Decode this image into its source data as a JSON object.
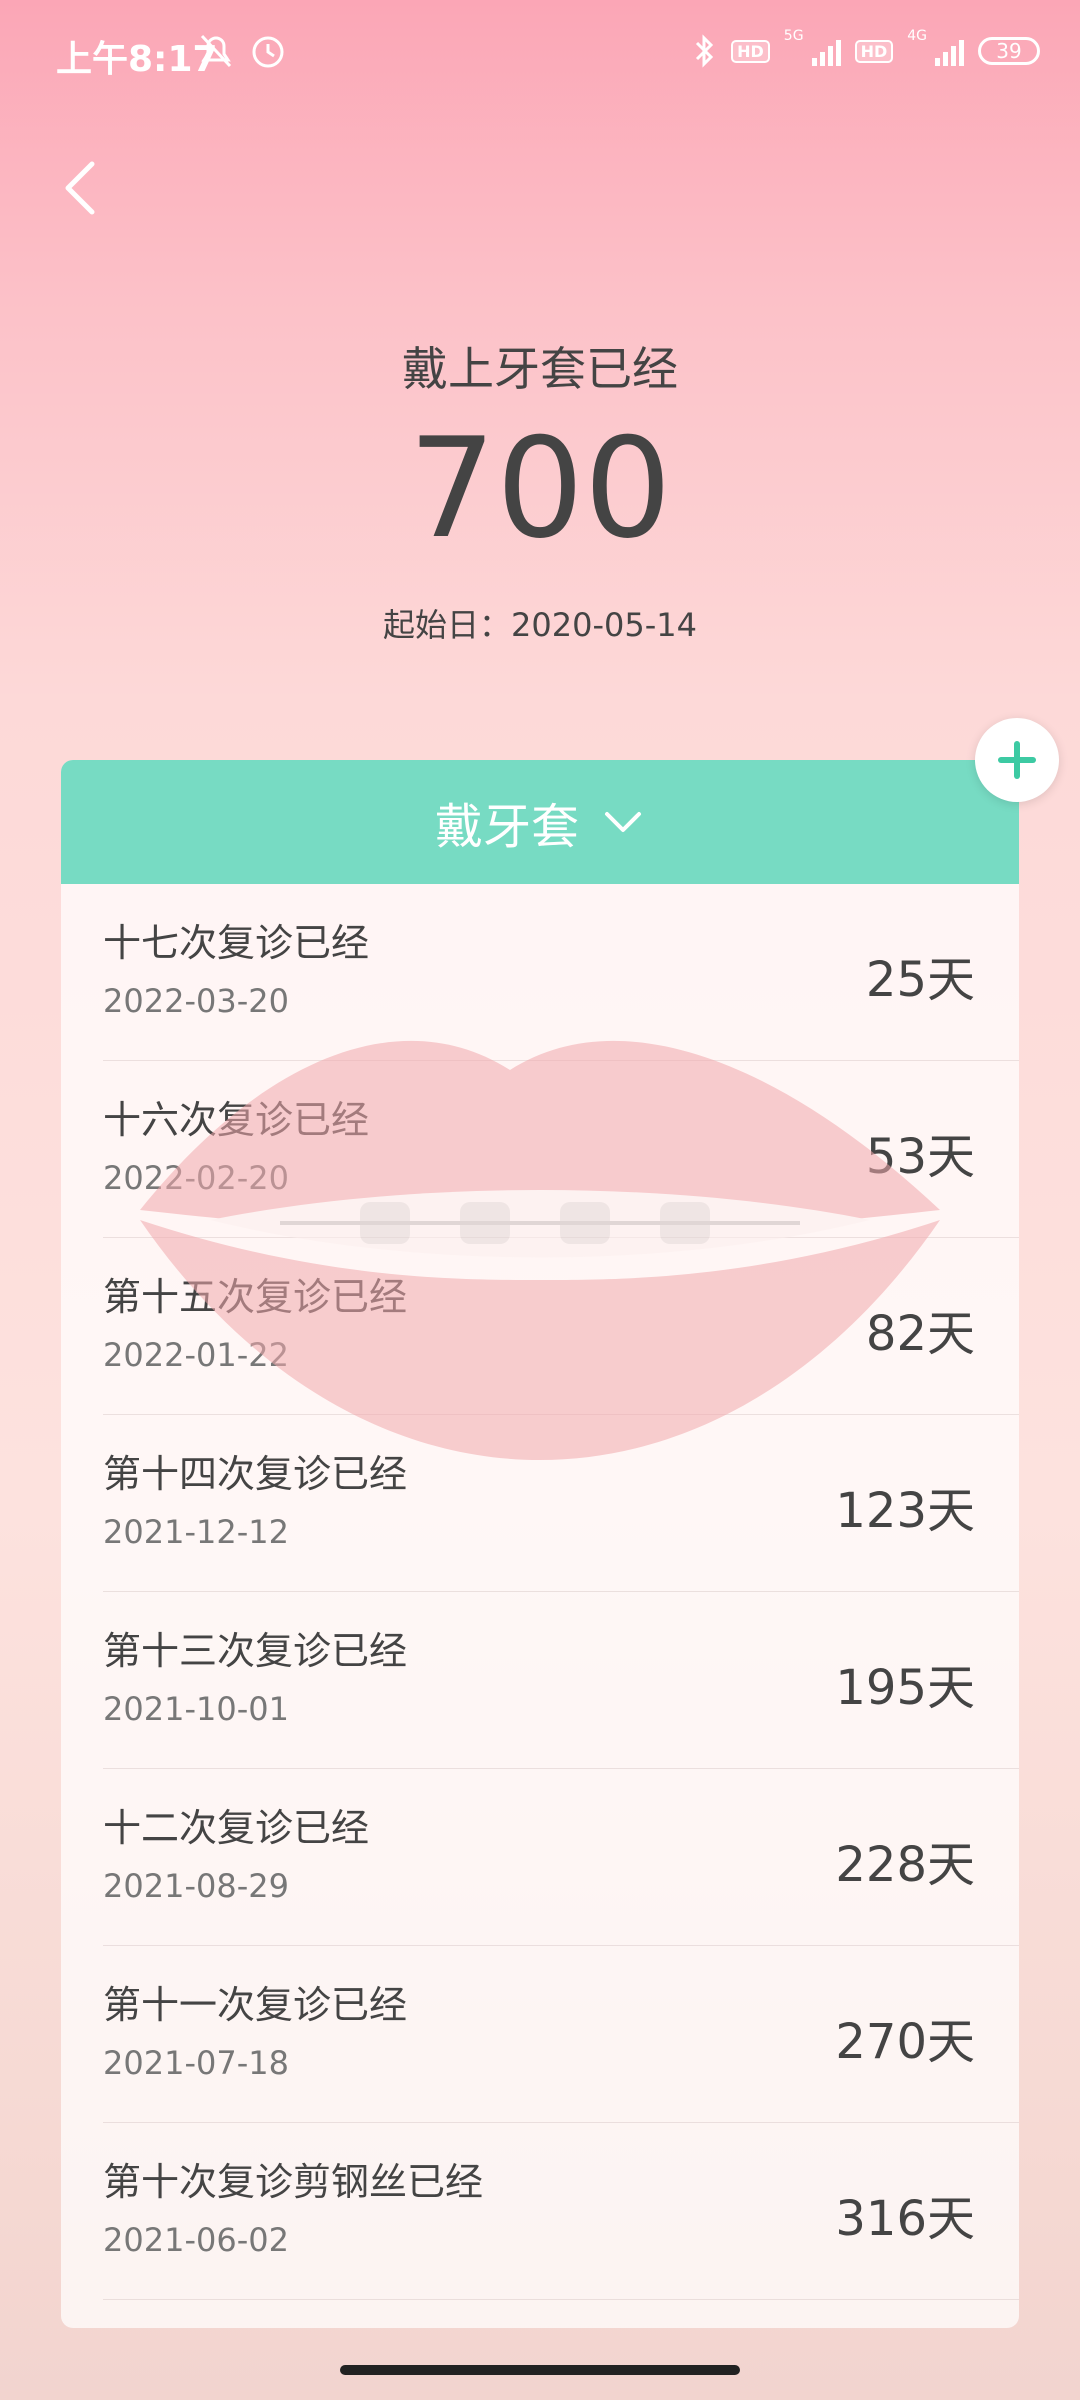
{
  "status_bar": {
    "time": "上午8:17",
    "hd1": "HD",
    "net1": "5G",
    "hd2": "HD",
    "net2": "4G",
    "battery": "39"
  },
  "header": {
    "title": "戴上牙套已经",
    "count": "700",
    "start_date": "起始日：2020-05-14"
  },
  "panel": {
    "category": "戴牙套"
  },
  "list": [
    {
      "title": "十七次复诊已经",
      "date": "2022-03-20",
      "days": "25天"
    },
    {
      "title": "十六次复诊已经",
      "date": "2022-02-20",
      "days": "53天"
    },
    {
      "title": "第十五次复诊已经",
      "date": "2022-01-22",
      "days": "82天"
    },
    {
      "title": "第十四次复诊已经",
      "date": "2021-12-12",
      "days": "123天"
    },
    {
      "title": "第十三次复诊已经",
      "date": "2021-10-01",
      "days": "195天"
    },
    {
      "title": "十二次复诊已经",
      "date": "2021-08-29",
      "days": "228天"
    },
    {
      "title": "第十一次复诊已经",
      "date": "2021-07-18",
      "days": "270天"
    },
    {
      "title": "第十次复诊剪钢丝已经",
      "date": "2021-06-02",
      "days": "316天"
    }
  ],
  "colors": {
    "accent": "#77dbc3",
    "add_icon": "#3dcaa3"
  }
}
